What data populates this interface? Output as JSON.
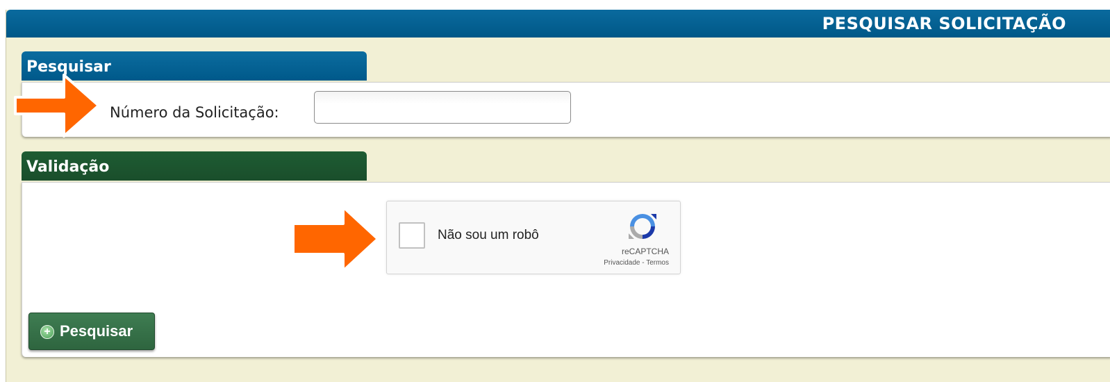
{
  "header": {
    "title": "PESQUISAR SOLICITAÇÃO"
  },
  "search_section": {
    "tab_label": "Pesquisar",
    "field_label": "Número da Solicitação:",
    "field_value": "",
    "field_placeholder": ""
  },
  "validation_section": {
    "tab_label": "Validação",
    "recaptcha": {
      "checkbox_label": "Não sou um robô",
      "brand": "reCAPTCHA",
      "privacy_link": "Privacidade",
      "separator": " - ",
      "terms_link": "Termos"
    },
    "search_button_label": "Pesquisar"
  },
  "annotations": {
    "arrow_color": "#ff6600",
    "arrow_count": 2
  },
  "colors": {
    "header_blue": "#005887",
    "section_green": "#1a4e2b",
    "background": "#f2f0d5",
    "button_green": "#2e653f"
  }
}
